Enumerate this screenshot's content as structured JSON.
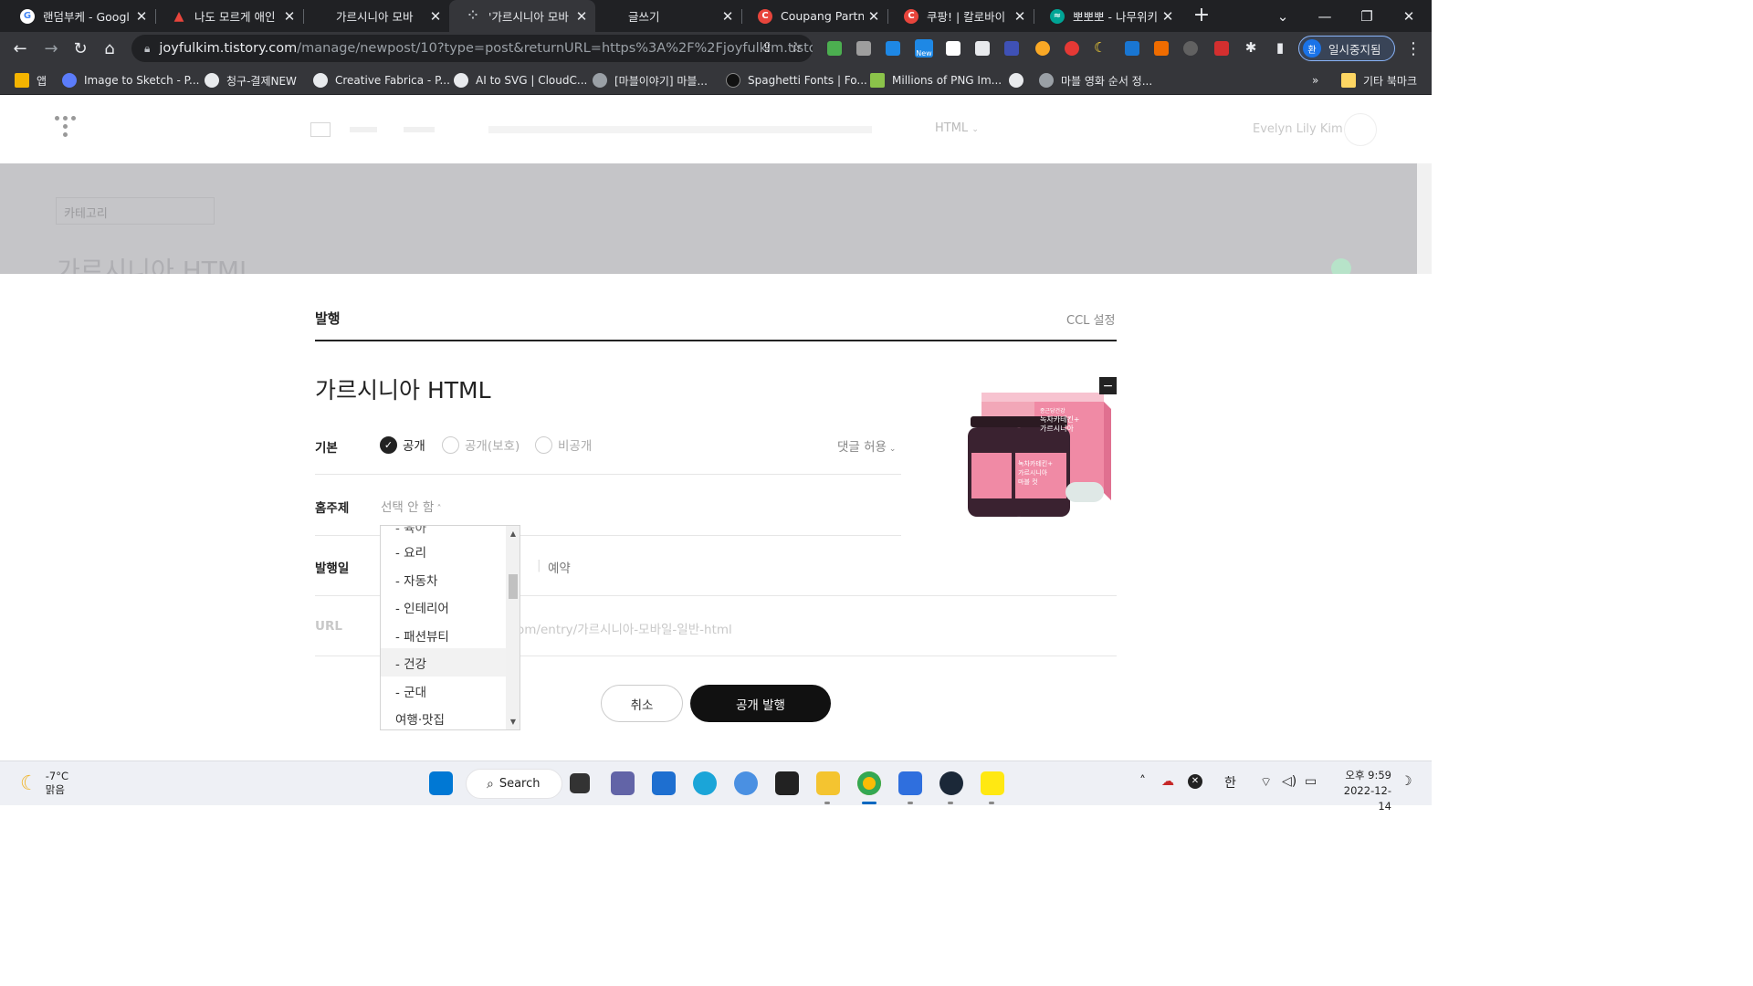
{
  "browser": {
    "tabs": [
      {
        "title": "랜덤부케 - Googl",
        "color": "#4285f4",
        "glyph": "G"
      },
      {
        "title": "나도 모르게 애인",
        "color": "#e8453c",
        "glyph": "▲"
      },
      {
        "title": "가르시니아 모바",
        "color": "#202124",
        "glyph": ""
      },
      {
        "title": "'가르시니아 모바",
        "color": "#9aa0a6",
        "glyph": "⁘"
      },
      {
        "title": "글쓰기",
        "color": "#202124",
        "glyph": ""
      },
      {
        "title": "Coupang Partners",
        "color": "#e8453c",
        "glyph": "C"
      },
      {
        "title": "쿠팡! | 칼로바이",
        "color": "#e8453c",
        "glyph": "C"
      },
      {
        "title": "뽀뽀뽀 - 나무위키",
        "color": "#00a495",
        "glyph": "≈"
      }
    ],
    "active_tab_index": 3,
    "url_host": "joyfulkim.tistory.com",
    "url_path": "/manage/newpost/10?type=post&returnURL=https%3A%2F%2Fjoyfulkim.tistor...",
    "profile_label": "일시중지됨",
    "profile_initial": "환",
    "new_badge": "New",
    "bookmarks": [
      {
        "label": "앱",
        "color": "#f4b400"
      },
      {
        "label": "Image to Sketch - P...",
        "color": "#5b7cfa"
      },
      {
        "label": "청구-결제NEW",
        "color": "#e8eaed"
      },
      {
        "label": "Creative Fabrica - P...",
        "color": "#e8eaed"
      },
      {
        "label": "AI to SVG | CloudC...",
        "color": "#e8eaed"
      },
      {
        "label": "[마블이야기] 마블...",
        "color": "#9aa0a6"
      },
      {
        "label": "Spaghetti Fonts | Fo...",
        "color": "#111111"
      },
      {
        "label": "Millions of PNG Im...",
        "color": "#8bc34a"
      },
      {
        "label": "",
        "color": "#e8eaed"
      },
      {
        "label": "마블 영화 순서 정...",
        "color": "#9aa0a6"
      }
    ],
    "bookmarks_overflow": "»",
    "other_bookmarks": "기타 북마크"
  },
  "editor": {
    "html_mode": "HTML",
    "user_name": "Evelyn Lily Kim",
    "category_placeholder": "카테고리",
    "title_ghost": "가르시니아 HTML"
  },
  "publish": {
    "heading": "발행",
    "ccl": "CCL 설정",
    "post_title": "가르시니아 HTML",
    "basic_label": "기본",
    "visibility": [
      {
        "label": "공개",
        "selected": true
      },
      {
        "label": "공개(보호)",
        "selected": false
      },
      {
        "label": "비공개",
        "selected": false
      }
    ],
    "comment_allow": "댓글 허용",
    "home_topic_label": "홈주제",
    "home_topic_value": "선택 안 함",
    "publish_date_label": "발행일",
    "publish_date_options": [
      "현재",
      "예약"
    ],
    "url_label": "URL",
    "url_value": "om/entry/가르시니아-모바일-일반-html",
    "cancel": "취소",
    "publish_button": "공개 발행",
    "thumbnail_product": {
      "brand": "종근당건강",
      "line1": "녹차카테킨+",
      "line2": "가르시니아",
      "line3": "마블 컷"
    }
  },
  "topic_dropdown": {
    "partial_top": "- 육아",
    "items": [
      "- 요리",
      "- 자동차",
      "- 인테리어",
      "- 패션뷰티",
      "- 건강",
      "- 군대",
      "여행·맛집"
    ],
    "hover_index": 4
  },
  "taskbar": {
    "temperature": "-7°C",
    "weather": "맑음",
    "search": "Search",
    "ime": "한",
    "time": "오후 9:59",
    "date": "2022-12-14"
  }
}
